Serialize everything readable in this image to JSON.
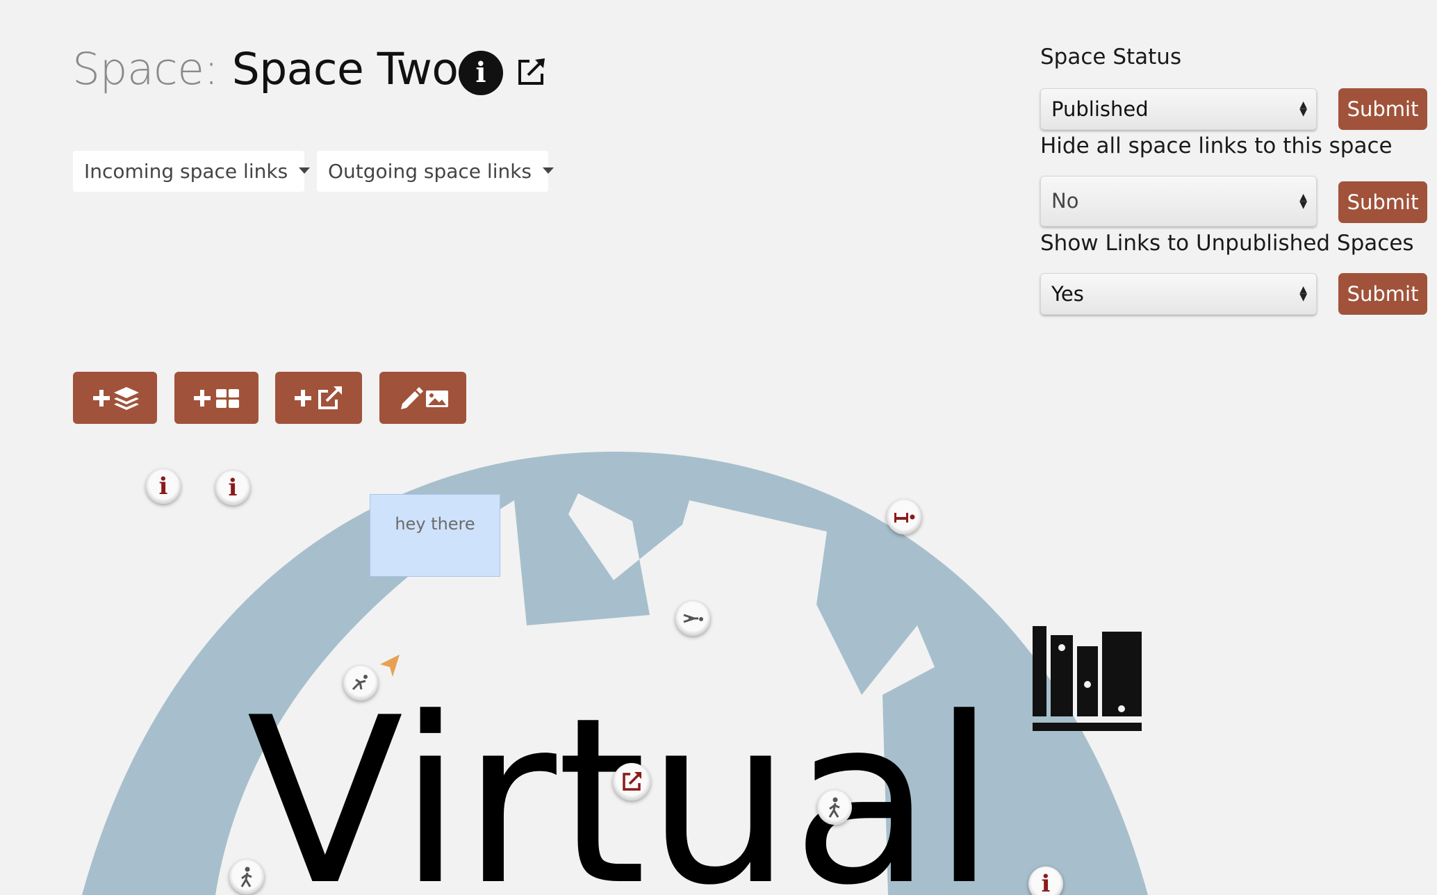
{
  "header": {
    "title_prefix": "Space:",
    "title_name": "Space Two"
  },
  "links": {
    "incoming_label": "Incoming space links",
    "outgoing_label": "Outgoing space links"
  },
  "settings": {
    "space_status": {
      "label": "Space Status",
      "value": "Published",
      "submit": "Submit"
    },
    "hide_links": {
      "label": "Hide all space links to this space",
      "value": "No",
      "submit": "Submit"
    },
    "show_unpublished": {
      "label": "Show Links to Unpublished Spaces",
      "value": "Yes",
      "submit": "Submit"
    }
  },
  "toolbar": {
    "buttons": [
      "add-layer",
      "add-grid",
      "add-external-link",
      "edit-background-image"
    ]
  },
  "map": {
    "background_title": "Virtual",
    "note_text": "hey there",
    "accent_color": "#a0533a",
    "map_color": "#a7bfcc",
    "marker_icons": [
      "info-icon",
      "info-icon",
      "bed-icon",
      "sleeping-person-icon",
      "jumping-person-icon",
      "external-link-icon",
      "walking-person-icon",
      "walking-person-icon",
      "info-icon",
      "paper-plane-icon"
    ]
  }
}
